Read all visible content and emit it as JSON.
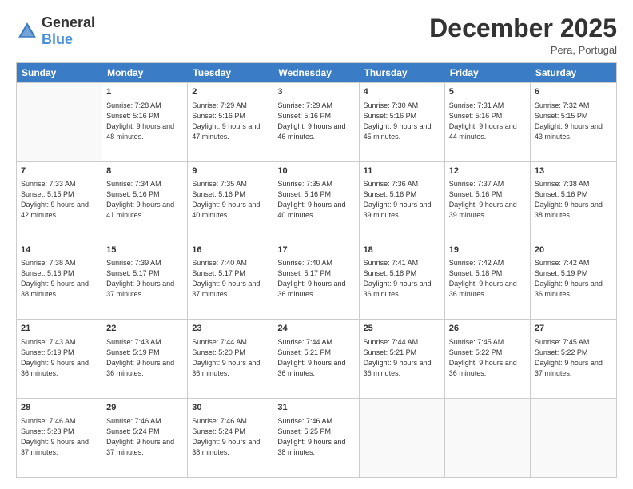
{
  "logo": {
    "general": "General",
    "blue": "Blue"
  },
  "header": {
    "month": "December 2025",
    "location": "Pera, Portugal"
  },
  "weekdays": [
    "Sunday",
    "Monday",
    "Tuesday",
    "Wednesday",
    "Thursday",
    "Friday",
    "Saturday"
  ],
  "rows": [
    [
      {
        "date": "",
        "sunrise": "",
        "sunset": "",
        "daylight": "",
        "empty": true
      },
      {
        "date": "1",
        "sunrise": "Sunrise: 7:28 AM",
        "sunset": "Sunset: 5:16 PM",
        "daylight": "Daylight: 9 hours and 48 minutes."
      },
      {
        "date": "2",
        "sunrise": "Sunrise: 7:29 AM",
        "sunset": "Sunset: 5:16 PM",
        "daylight": "Daylight: 9 hours and 47 minutes."
      },
      {
        "date": "3",
        "sunrise": "Sunrise: 7:29 AM",
        "sunset": "Sunset: 5:16 PM",
        "daylight": "Daylight: 9 hours and 46 minutes."
      },
      {
        "date": "4",
        "sunrise": "Sunrise: 7:30 AM",
        "sunset": "Sunset: 5:16 PM",
        "daylight": "Daylight: 9 hours and 45 minutes."
      },
      {
        "date": "5",
        "sunrise": "Sunrise: 7:31 AM",
        "sunset": "Sunset: 5:16 PM",
        "daylight": "Daylight: 9 hours and 44 minutes."
      },
      {
        "date": "6",
        "sunrise": "Sunrise: 7:32 AM",
        "sunset": "Sunset: 5:15 PM",
        "daylight": "Daylight: 9 hours and 43 minutes."
      }
    ],
    [
      {
        "date": "7",
        "sunrise": "Sunrise: 7:33 AM",
        "sunset": "Sunset: 5:15 PM",
        "daylight": "Daylight: 9 hours and 42 minutes."
      },
      {
        "date": "8",
        "sunrise": "Sunrise: 7:34 AM",
        "sunset": "Sunset: 5:16 PM",
        "daylight": "Daylight: 9 hours and 41 minutes."
      },
      {
        "date": "9",
        "sunrise": "Sunrise: 7:35 AM",
        "sunset": "Sunset: 5:16 PM",
        "daylight": "Daylight: 9 hours and 40 minutes."
      },
      {
        "date": "10",
        "sunrise": "Sunrise: 7:35 AM",
        "sunset": "Sunset: 5:16 PM",
        "daylight": "Daylight: 9 hours and 40 minutes."
      },
      {
        "date": "11",
        "sunrise": "Sunrise: 7:36 AM",
        "sunset": "Sunset: 5:16 PM",
        "daylight": "Daylight: 9 hours and 39 minutes."
      },
      {
        "date": "12",
        "sunrise": "Sunrise: 7:37 AM",
        "sunset": "Sunset: 5:16 PM",
        "daylight": "Daylight: 9 hours and 39 minutes."
      },
      {
        "date": "13",
        "sunrise": "Sunrise: 7:38 AM",
        "sunset": "Sunset: 5:16 PM",
        "daylight": "Daylight: 9 hours and 38 minutes."
      }
    ],
    [
      {
        "date": "14",
        "sunrise": "Sunrise: 7:38 AM",
        "sunset": "Sunset: 5:16 PM",
        "daylight": "Daylight: 9 hours and 38 minutes."
      },
      {
        "date": "15",
        "sunrise": "Sunrise: 7:39 AM",
        "sunset": "Sunset: 5:17 PM",
        "daylight": "Daylight: 9 hours and 37 minutes."
      },
      {
        "date": "16",
        "sunrise": "Sunrise: 7:40 AM",
        "sunset": "Sunset: 5:17 PM",
        "daylight": "Daylight: 9 hours and 37 minutes."
      },
      {
        "date": "17",
        "sunrise": "Sunrise: 7:40 AM",
        "sunset": "Sunset: 5:17 PM",
        "daylight": "Daylight: 9 hours and 36 minutes."
      },
      {
        "date": "18",
        "sunrise": "Sunrise: 7:41 AM",
        "sunset": "Sunset: 5:18 PM",
        "daylight": "Daylight: 9 hours and 36 minutes."
      },
      {
        "date": "19",
        "sunrise": "Sunrise: 7:42 AM",
        "sunset": "Sunset: 5:18 PM",
        "daylight": "Daylight: 9 hours and 36 minutes."
      },
      {
        "date": "20",
        "sunrise": "Sunrise: 7:42 AM",
        "sunset": "Sunset: 5:19 PM",
        "daylight": "Daylight: 9 hours and 36 minutes."
      }
    ],
    [
      {
        "date": "21",
        "sunrise": "Sunrise: 7:43 AM",
        "sunset": "Sunset: 5:19 PM",
        "daylight": "Daylight: 9 hours and 36 minutes."
      },
      {
        "date": "22",
        "sunrise": "Sunrise: 7:43 AM",
        "sunset": "Sunset: 5:19 PM",
        "daylight": "Daylight: 9 hours and 36 minutes."
      },
      {
        "date": "23",
        "sunrise": "Sunrise: 7:44 AM",
        "sunset": "Sunset: 5:20 PM",
        "daylight": "Daylight: 9 hours and 36 minutes."
      },
      {
        "date": "24",
        "sunrise": "Sunrise: 7:44 AM",
        "sunset": "Sunset: 5:21 PM",
        "daylight": "Daylight: 9 hours and 36 minutes."
      },
      {
        "date": "25",
        "sunrise": "Sunrise: 7:44 AM",
        "sunset": "Sunset: 5:21 PM",
        "daylight": "Daylight: 9 hours and 36 minutes."
      },
      {
        "date": "26",
        "sunrise": "Sunrise: 7:45 AM",
        "sunset": "Sunset: 5:22 PM",
        "daylight": "Daylight: 9 hours and 36 minutes."
      },
      {
        "date": "27",
        "sunrise": "Sunrise: 7:45 AM",
        "sunset": "Sunset: 5:22 PM",
        "daylight": "Daylight: 9 hours and 37 minutes."
      }
    ],
    [
      {
        "date": "28",
        "sunrise": "Sunrise: 7:46 AM",
        "sunset": "Sunset: 5:23 PM",
        "daylight": "Daylight: 9 hours and 37 minutes."
      },
      {
        "date": "29",
        "sunrise": "Sunrise: 7:46 AM",
        "sunset": "Sunset: 5:24 PM",
        "daylight": "Daylight: 9 hours and 37 minutes."
      },
      {
        "date": "30",
        "sunrise": "Sunrise: 7:46 AM",
        "sunset": "Sunset: 5:24 PM",
        "daylight": "Daylight: 9 hours and 38 minutes."
      },
      {
        "date": "31",
        "sunrise": "Sunrise: 7:46 AM",
        "sunset": "Sunset: 5:25 PM",
        "daylight": "Daylight: 9 hours and 38 minutes."
      },
      {
        "date": "",
        "sunrise": "",
        "sunset": "",
        "daylight": "",
        "empty": true
      },
      {
        "date": "",
        "sunrise": "",
        "sunset": "",
        "daylight": "",
        "empty": true
      },
      {
        "date": "",
        "sunrise": "",
        "sunset": "",
        "daylight": "",
        "empty": true
      }
    ]
  ]
}
